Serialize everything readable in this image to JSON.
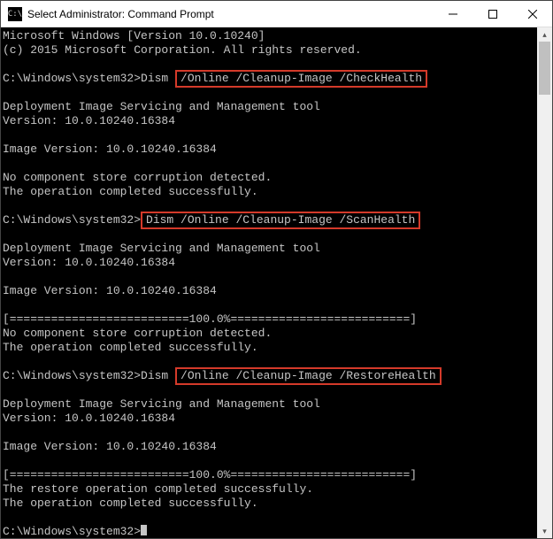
{
  "titlebar": {
    "icon_glyph": "C:\\",
    "title": "Select Administrator: Command Prompt"
  },
  "terminal": {
    "header_line1": "Microsoft Windows [Version 10.0.10240]",
    "header_line2": "(c) 2015 Microsoft Corporation. All rights reserved.",
    "prompt1_prefix": "C:\\Windows\\system32>Dism ",
    "cmd1_highlight": "/Online /Cleanup-Image /CheckHealth",
    "tool_line1": "Deployment Image Servicing and Management tool",
    "tool_line2": "Version: 10.0.10240.16384",
    "imgver": "Image Version: 10.0.10240.16384",
    "nocorrupt": "No component store corruption detected.",
    "opsuccess": "The operation completed successfully.",
    "prompt2_prefix": "C:\\Windows\\system32>",
    "cmd2_highlight": "Dism /Online /Cleanup-Image /ScanHealth",
    "progress": "[==========================100.0%==========================]",
    "prompt3_prefix": "C:\\Windows\\system32>Dism ",
    "cmd3_highlight": "/Online /Cleanup-Image /RestoreHealth",
    "restoresuccess": "The restore operation completed successfully.",
    "final_prompt": "C:\\Windows\\system32>"
  }
}
